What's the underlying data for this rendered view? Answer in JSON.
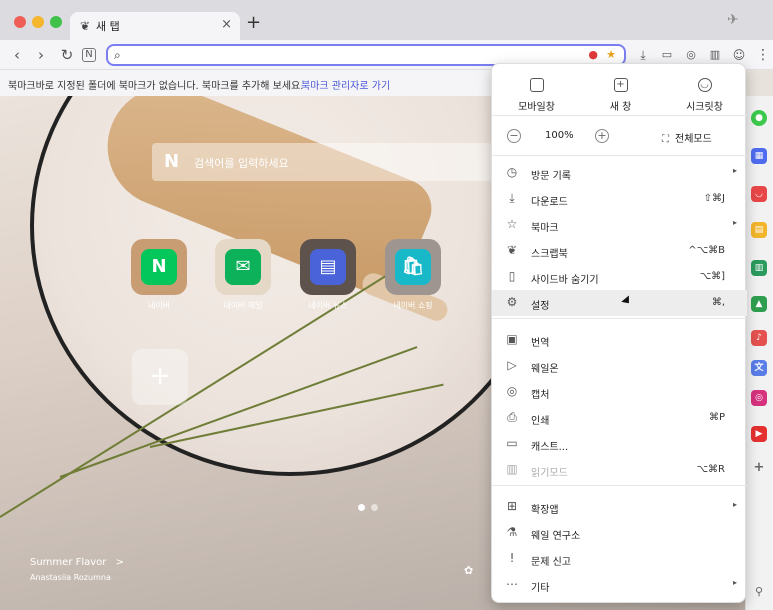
{
  "tab": {
    "title": "새 탭",
    "close": "×",
    "new_tab": "+"
  },
  "toolbar": {
    "back": "‹",
    "forward": "›",
    "reload": "↻",
    "address_value": "",
    "address_placeholder": ""
  },
  "bookmark_bar": {
    "message": "북마크바로 지정된 폴더에 북마크가 없습니다. 북마크를 추가해 보세요.",
    "link": "북마크 관리자로 가기"
  },
  "content": {
    "search_placeholder": "검색어를 입력하세요",
    "search_logo": "N",
    "shortcuts": [
      {
        "label": "네이버",
        "glyph": "N",
        "color": "#03c75a",
        "bg": "#c99d73"
      },
      {
        "label": "네이버 메일",
        "glyph": "✉",
        "color": "#0cb15a",
        "bg": "#e6d8c6"
      },
      {
        "label": "네이버 뉴스",
        "glyph": "▤",
        "color": "#4a63d8",
        "bg": "#5e534c"
      },
      {
        "label": "네이버 쇼핑",
        "glyph": "🛍",
        "color": "#17b8c8",
        "bg": "#9e9591"
      }
    ],
    "add_tile": "+",
    "photo_title": "Summer Flavor",
    "photo_title_arrow": ">",
    "photo_author": "Anastasiia Rozumna"
  },
  "menu": {
    "top": [
      {
        "label": "모바일창",
        "icon": "phone-icon"
      },
      {
        "label": "새 창",
        "icon": "new-window-icon"
      },
      {
        "label": "시크릿창",
        "icon": "incognito-icon"
      }
    ],
    "zoom": {
      "minus": "−",
      "plus": "+",
      "value": "100%",
      "fullscreen": "전체모드"
    },
    "items": [
      {
        "label": "방문 기록",
        "shortcut": "",
        "submenu": true,
        "icon": "history-icon",
        "glyph": "◷"
      },
      {
        "label": "다운로드",
        "shortcut": "⇧⌘J",
        "submenu": false,
        "icon": "download-icon",
        "glyph": "⤓"
      },
      {
        "label": "북마크",
        "shortcut": "",
        "submenu": true,
        "icon": "star-icon",
        "glyph": "☆"
      },
      {
        "label": "스크랩북",
        "shortcut": "^⌥⌘B",
        "submenu": false,
        "icon": "scrapbook-icon",
        "glyph": "❦"
      },
      {
        "label": "사이드바 숨기기",
        "shortcut": "⌥⌘]",
        "submenu": false,
        "icon": "sidebar-icon",
        "glyph": "▯"
      },
      {
        "label": "설정",
        "shortcut": "⌘,",
        "submenu": false,
        "icon": "gear-icon",
        "glyph": "⚙"
      },
      {
        "label": "번역",
        "shortcut": "",
        "submenu": false,
        "icon": "translate-icon",
        "glyph": "▣"
      },
      {
        "label": "웨일온",
        "shortcut": "",
        "submenu": false,
        "icon": "whale-on-icon",
        "glyph": "▷"
      },
      {
        "label": "캡처",
        "shortcut": "",
        "submenu": false,
        "icon": "capture-icon",
        "glyph": "◎"
      },
      {
        "label": "인쇄",
        "shortcut": "⌘P",
        "submenu": false,
        "icon": "print-icon",
        "glyph": "⎙"
      },
      {
        "label": "캐스트...",
        "shortcut": "",
        "submenu": false,
        "icon": "cast-icon",
        "glyph": "▭"
      },
      {
        "label": "읽기모드",
        "shortcut": "⌥⌘R",
        "submenu": false,
        "icon": "reader-mode-icon",
        "glyph": "▥"
      },
      {
        "label": "확장앱",
        "shortcut": "",
        "submenu": true,
        "icon": "extensions-icon",
        "glyph": "⊞"
      },
      {
        "label": "웨일 연구소",
        "shortcut": "",
        "submenu": false,
        "icon": "lab-icon",
        "glyph": "⚗"
      },
      {
        "label": "문제 신고",
        "shortcut": "",
        "submenu": false,
        "icon": "report-icon",
        "glyph": "!"
      },
      {
        "label": "기타",
        "shortcut": "",
        "submenu": true,
        "icon": "more-icon",
        "glyph": "⋯"
      }
    ]
  }
}
